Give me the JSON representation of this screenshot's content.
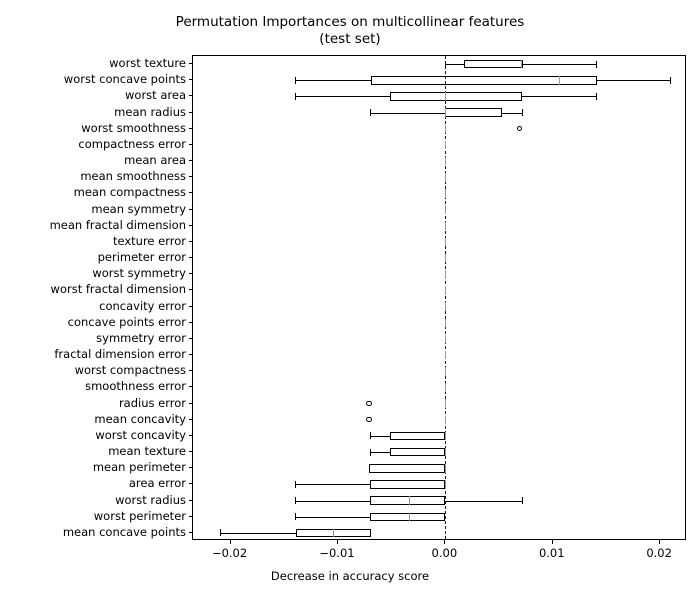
{
  "chart_data": {
    "type": "box",
    "title": "Permutation Importances on multicollinear features\n(test set)",
    "xlabel": "Decrease in accuracy score",
    "ylabel": "",
    "orientation": "horizontal",
    "xlim": [
      -0.0235,
      0.0225
    ],
    "grid": false,
    "legend": null,
    "reference_line": {
      "value": 0.0,
      "style": "dashed",
      "color": "#1a1a1a"
    },
    "xticks": [
      -0.02,
      -0.01,
      0.0,
      0.01,
      0.02
    ],
    "xticklabels": [
      "−0.02",
      "−0.01",
      "0.00",
      "0.01",
      "0.02"
    ],
    "categories": [
      "worst texture",
      "worst concave points",
      "worst area",
      "mean radius",
      "worst smoothness",
      "compactness error",
      "mean area",
      "mean smoothness",
      "mean compactness",
      "mean symmetry",
      "mean fractal dimension",
      "texture error",
      "perimeter error",
      "worst symmetry",
      "worst fractal dimension",
      "concavity error",
      "concave points error",
      "symmetry error",
      "fractal dimension error",
      "worst compactness",
      "smoothness error",
      "radius error",
      "mean concavity",
      "worst concavity",
      "mean texture",
      "mean perimeter",
      "area error",
      "worst radius",
      "worst perimeter",
      "mean concave points"
    ],
    "boxes": [
      {
        "label": "worst texture",
        "whisker_low": 0.0,
        "q1": 0.00175,
        "median": 0.007,
        "q3": 0.0072,
        "whisker_high": 0.014,
        "fliers": []
      },
      {
        "label": "worst concave points",
        "whisker_low": -0.014,
        "q1": -0.0069,
        "median": 0.01055,
        "q3": 0.0141,
        "whisker_high": 0.0209,
        "fliers": []
      },
      {
        "label": "worst area",
        "whisker_low": -0.014,
        "q1": -0.0052,
        "median": 0.0,
        "q3": 0.00715,
        "whisker_high": 0.014,
        "fliers": []
      },
      {
        "label": "mean radius",
        "whisker_low": -0.007,
        "q1": -5e-05,
        "median": 0.0,
        "q3": 0.0053,
        "whisker_high": 0.0071,
        "fliers": []
      },
      {
        "label": "worst smoothness",
        "whisker_low": 0.0,
        "q1": 0.0,
        "median": 0.0,
        "q3": 0.0,
        "whisker_high": 0.0,
        "fliers": [
          0.0069
        ]
      },
      {
        "label": "compactness error",
        "whisker_low": 0.0,
        "q1": 0.0,
        "median": 0.0,
        "q3": 0.0,
        "whisker_high": 0.0,
        "fliers": []
      },
      {
        "label": "mean area",
        "whisker_low": 0.0,
        "q1": 0.0,
        "median": 0.0,
        "q3": 0.0,
        "whisker_high": 0.0,
        "fliers": []
      },
      {
        "label": "mean smoothness",
        "whisker_low": 0.0,
        "q1": 0.0,
        "median": 0.0,
        "q3": 0.0,
        "whisker_high": 0.0,
        "fliers": []
      },
      {
        "label": "mean compactness",
        "whisker_low": 0.0,
        "q1": 0.0,
        "median": 0.0,
        "q3": 0.0,
        "whisker_high": 0.0,
        "fliers": []
      },
      {
        "label": "mean symmetry",
        "whisker_low": 0.0,
        "q1": 0.0,
        "median": 0.0,
        "q3": 0.0,
        "whisker_high": 0.0,
        "fliers": []
      },
      {
        "label": "mean fractal dimension",
        "whisker_low": 0.0,
        "q1": 0.0,
        "median": 0.0,
        "q3": 0.0,
        "whisker_high": 0.0,
        "fliers": []
      },
      {
        "label": "texture error",
        "whisker_low": 0.0,
        "q1": 0.0,
        "median": 0.0,
        "q3": 0.0,
        "whisker_high": 0.0,
        "fliers": []
      },
      {
        "label": "perimeter error",
        "whisker_low": 0.0,
        "q1": 0.0,
        "median": 0.0,
        "q3": 0.0,
        "whisker_high": 0.0,
        "fliers": []
      },
      {
        "label": "worst symmetry",
        "whisker_low": 0.0,
        "q1": 0.0,
        "median": 0.0,
        "q3": 0.0,
        "whisker_high": 0.0,
        "fliers": []
      },
      {
        "label": "worst fractal dimension",
        "whisker_low": 0.0,
        "q1": 0.0,
        "median": 0.0,
        "q3": 0.0,
        "whisker_high": 0.0,
        "fliers": []
      },
      {
        "label": "concavity error",
        "whisker_low": 0.0,
        "q1": 0.0,
        "median": 0.0,
        "q3": 0.0,
        "whisker_high": 0.0,
        "fliers": []
      },
      {
        "label": "concave points error",
        "whisker_low": 0.0,
        "q1": 0.0,
        "median": 0.0,
        "q3": 0.0,
        "whisker_high": 0.0,
        "fliers": []
      },
      {
        "label": "symmetry error",
        "whisker_low": 0.0,
        "q1": 0.0,
        "median": 0.0,
        "q3": 0.0,
        "whisker_high": 0.0,
        "fliers": []
      },
      {
        "label": "fractal dimension error",
        "whisker_low": 0.0,
        "q1": 0.0,
        "median": 0.0,
        "q3": 0.0,
        "whisker_high": 0.0,
        "fliers": []
      },
      {
        "label": "worst compactness",
        "whisker_low": 0.0,
        "q1": 0.0,
        "median": 0.0,
        "q3": 0.0,
        "whisker_high": 0.0,
        "fliers": []
      },
      {
        "label": "smoothness error",
        "whisker_low": 0.0,
        "q1": 0.0,
        "median": 0.0,
        "q3": 0.0,
        "whisker_high": 0.0,
        "fliers": []
      },
      {
        "label": "radius error",
        "whisker_low": 0.0,
        "q1": 0.0,
        "median": 0.0,
        "q3": 0.0,
        "whisker_high": 0.0,
        "fliers": [
          -0.0071
        ]
      },
      {
        "label": "mean concavity",
        "whisker_low": 0.0,
        "q1": 0.0,
        "median": 0.0,
        "q3": 0.0,
        "whisker_high": 0.0,
        "fliers": [
          -0.0071
        ]
      },
      {
        "label": "worst concavity",
        "whisker_low": -0.007,
        "q1": -0.0052,
        "median": 0.0,
        "q3": 0.0,
        "whisker_high": 0.0,
        "fliers": []
      },
      {
        "label": "mean texture",
        "whisker_low": -0.007,
        "q1": -0.0052,
        "median": 0.0,
        "q3": 0.0,
        "whisker_high": 0.0,
        "fliers": []
      },
      {
        "label": "mean perimeter",
        "whisker_low": -0.0071,
        "q1": -0.0071,
        "median": 0.0,
        "q3": 0.0,
        "whisker_high": 0.0,
        "fliers": []
      },
      {
        "label": "area error",
        "whisker_low": -0.014,
        "q1": -0.007,
        "median": 0.0,
        "q3": 0.0,
        "whisker_high": 0.0,
        "fliers": []
      },
      {
        "label": "worst radius",
        "whisker_low": -0.014,
        "q1": -0.007,
        "median": -0.0034,
        "q3": 0.0,
        "whisker_high": 0.0071,
        "fliers": []
      },
      {
        "label": "worst perimeter",
        "whisker_low": -0.014,
        "q1": -0.007,
        "median": -0.0034,
        "q3": 0.0,
        "whisker_high": 0.0,
        "fliers": []
      },
      {
        "label": "mean concave points",
        "whisker_low": -0.021,
        "q1": -0.0139,
        "median": -0.0105,
        "q3": -0.0069,
        "whisker_high": -0.0069,
        "fliers": []
      }
    ],
    "colors": {
      "box_edge": "#000000",
      "median": "#ff7f0e",
      "whisker": "#000000",
      "flier_edge": "#000000",
      "zero_line": "#1a1a1a",
      "background": "#ffffff"
    }
  }
}
